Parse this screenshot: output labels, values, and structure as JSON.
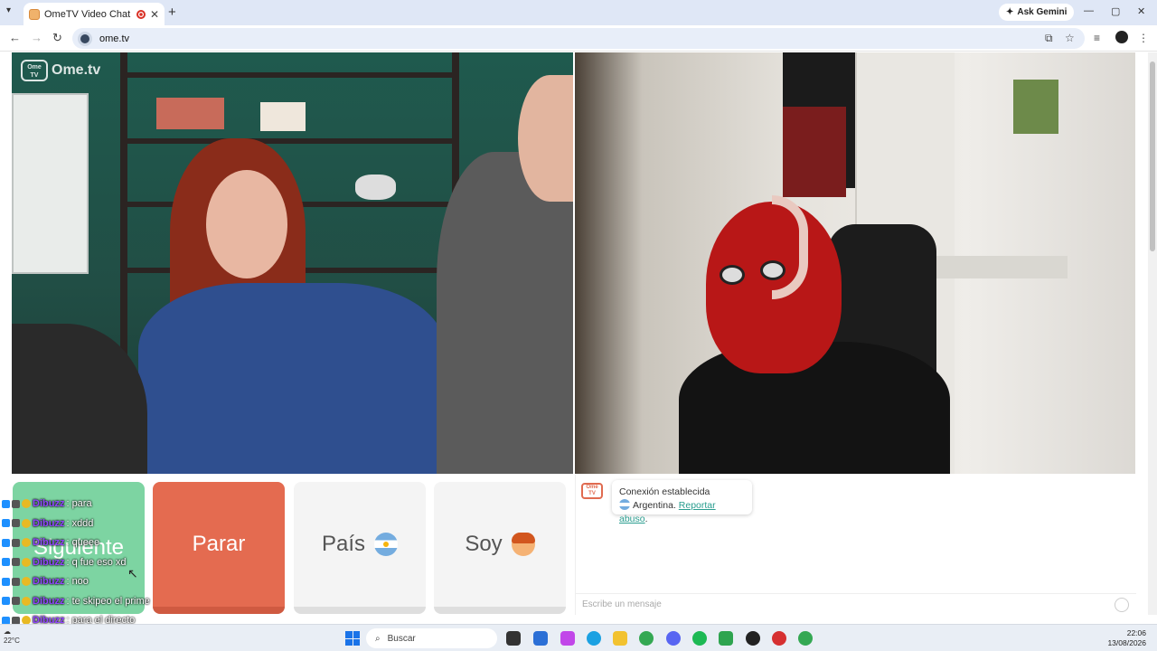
{
  "browser": {
    "tab_title": "OmeTV Video Chat — Ome",
    "tab_close": "✕",
    "new_tab": "+",
    "gemini_label": "Ask Gemini",
    "url": "ome.tv",
    "window_controls": [
      "—",
      "▢",
      "✕"
    ]
  },
  "video": {
    "logo_text": "Ome.tv",
    "logo_badge": "Ome TV"
  },
  "buttons": {
    "next": "Siguiente",
    "stop": "Parar",
    "country": "País",
    "soy": "Soy"
  },
  "chat": {
    "status": "Conexión establecida",
    "country": "Argentina.",
    "report": "Reportar abuso",
    "report_end": ".",
    "placeholder": "Escribe un mensaje",
    "logo": "Ome TV"
  },
  "stream_chat": [
    {
      "user": "Dibuzz",
      "msg": ": para"
    },
    {
      "user": "Dibuzz",
      "msg": ": xddd"
    },
    {
      "user": "Dibuzz",
      "msg": ": queee"
    },
    {
      "user": "Dibuzz",
      "msg": ": q fue eso xd"
    },
    {
      "user": "Dibuzz",
      "msg": ": noo"
    },
    {
      "user": "Dibuzz",
      "msg": ": te skipeo el prime"
    },
    {
      "user": "Dibuzz",
      "msg": ": para el directo"
    },
    {
      "user": "Dibuzz",
      "msg": ": xddd"
    }
  ],
  "taskbar": {
    "search": "Buscar",
    "weather": "22°C",
    "time": "22:06",
    "date": "13/08/2026"
  },
  "colors": {
    "next": "#7dd4a2",
    "stop": "#e46b50",
    "link": "#2a9d8f",
    "chat_user": "#9146ff"
  }
}
